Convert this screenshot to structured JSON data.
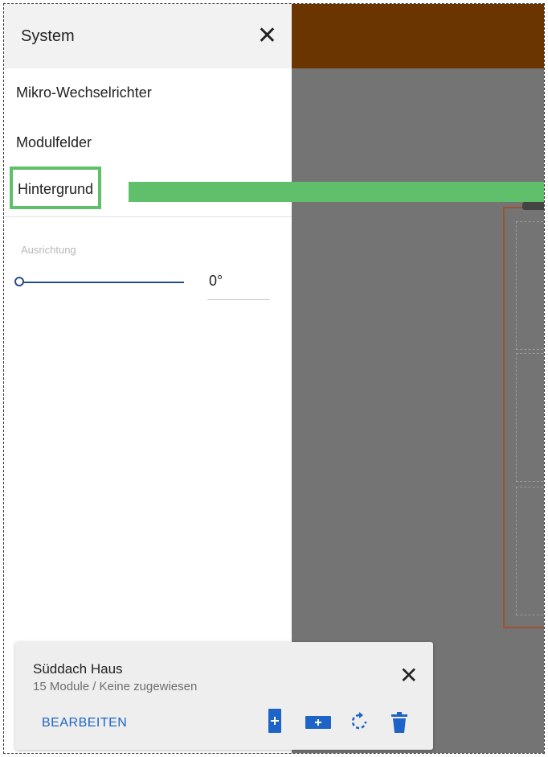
{
  "panel": {
    "title": "System",
    "menu": [
      {
        "label": "Mikro-Wechselrichter"
      },
      {
        "label": "Modulfelder"
      },
      {
        "label": "Hintergrund",
        "selected": true
      }
    ],
    "orientation": {
      "label": "Ausrichtung",
      "value": "0°",
      "slider_fraction": 0
    }
  },
  "card": {
    "title": "Süddach Haus",
    "subtitle": "15 Module / Keine zugewiesen",
    "edit_label": "BEARBEITEN",
    "icons": [
      "add-module-icon",
      "add-row-icon",
      "rotate-icon",
      "trash-icon"
    ]
  },
  "colors": {
    "accent_blue": "#1e63c7",
    "highlight_green": "#5fbf6a",
    "header_brown": "#6b3500",
    "slider_blue": "#274c8a"
  }
}
